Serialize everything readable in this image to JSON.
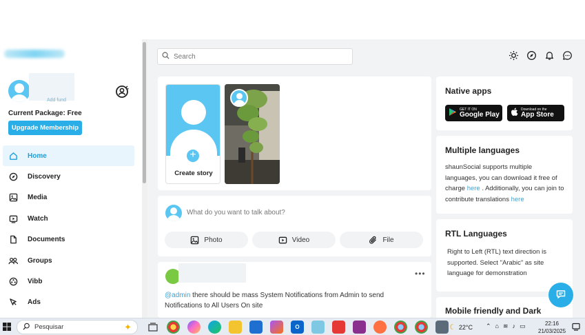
{
  "sidebar": {
    "add_fund": "Add fund",
    "package": "Current Package: Free",
    "upgrade_label": "Upgrade Membership",
    "items": [
      {
        "label": "Home",
        "icon": "home-icon",
        "active": true
      },
      {
        "label": "Discovery",
        "icon": "compass-icon"
      },
      {
        "label": "Media",
        "icon": "image-icon"
      },
      {
        "label": "Watch",
        "icon": "play-icon"
      },
      {
        "label": "Documents",
        "icon": "document-icon"
      },
      {
        "label": "Groups",
        "icon": "groups-icon"
      },
      {
        "label": "Vibb",
        "icon": "vibb-icon"
      },
      {
        "label": "Ads",
        "icon": "ads-icon"
      }
    ]
  },
  "header": {
    "search_placeholder": "Search",
    "icons": [
      "sun-icon",
      "compass-icon",
      "bell-icon",
      "chat-icon"
    ]
  },
  "stories": {
    "create_label": "Create story"
  },
  "composer": {
    "placeholder": "What do you want to talk about?",
    "photo_label": "Photo",
    "video_label": "Video",
    "file_label": "File"
  },
  "post": {
    "mention": "@admin",
    "text": " there should be mass System Notifications from Admin to send Notifications to All Users On site"
  },
  "right": {
    "native_title": "Native apps",
    "google_small": "GET IT ON",
    "google_large": "Google Play",
    "apple_small": "Download on the",
    "apple_large": "App Store",
    "lang_title": "Multiple languages",
    "lang_text_1": "shaunSocial supports multiple languages, you can download it free of charge ",
    "lang_link_1": "here",
    "lang_text_2": " . Additionally, you can join to contribute translations ",
    "lang_link_2": "here",
    "rtl_title": "RTL Languages",
    "rtl_text": "Right to Left (RTL) text direction is supported. Select \"Arabic\" as site language for demonstration",
    "mobile_title": "Mobile friendly and Dark"
  },
  "taskbar": {
    "search_label": "Pesquisar",
    "temperature": "22°C",
    "time": "22:16",
    "date": "21/03/2025"
  },
  "colors": {
    "accent": "#29aee8",
    "link": "#3aa3d6",
    "active_bg": "#e8f5fc"
  }
}
